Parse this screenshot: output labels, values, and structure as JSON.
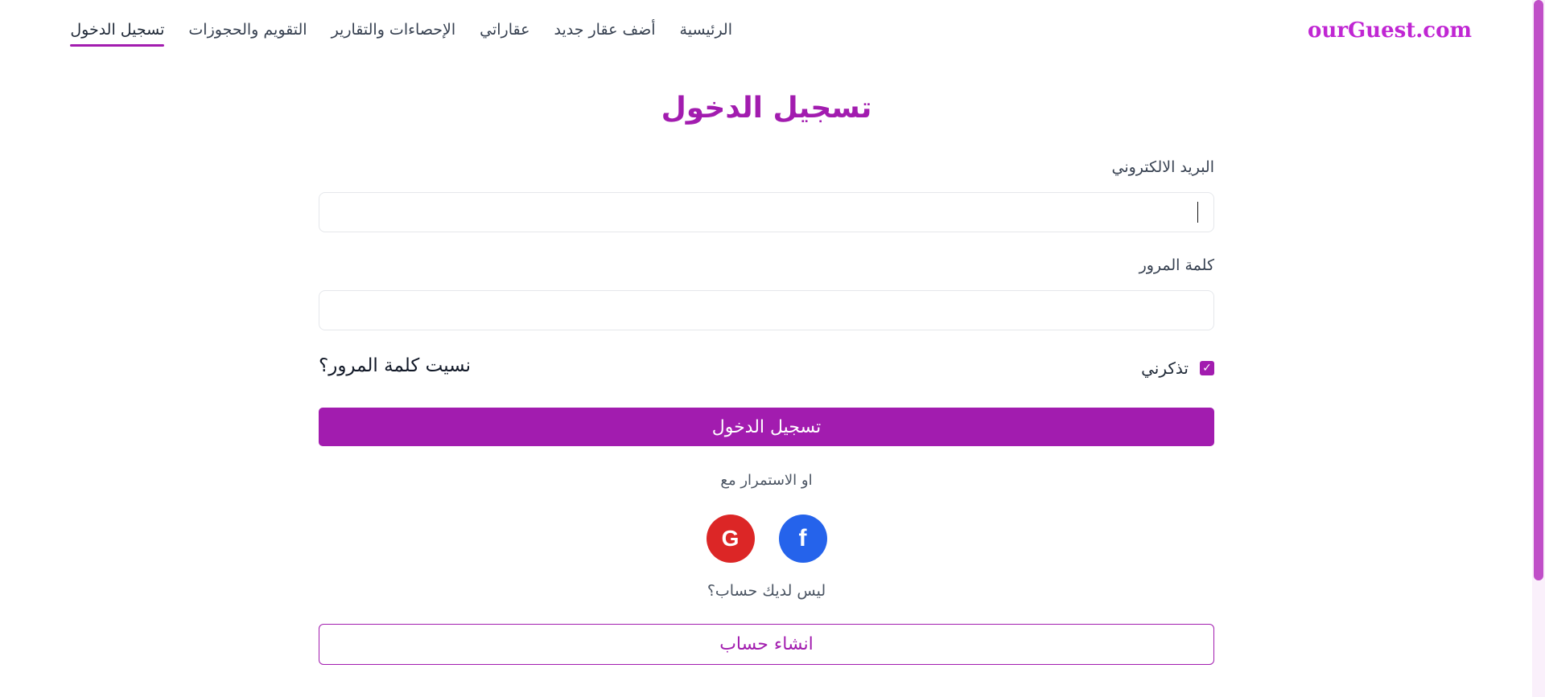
{
  "header": {
    "brand": "ourGuest.com",
    "nav": [
      {
        "label": "الرئيسية"
      },
      {
        "label": "أضف عقار جديد"
      },
      {
        "label": "عقاراتي"
      },
      {
        "label": "الإحصاءات والتقارير"
      },
      {
        "label": "التقويم والحجوزات"
      },
      {
        "label": "تسجيل الدخول",
        "active": true
      }
    ]
  },
  "form": {
    "title": "تسجيل الدخول",
    "email_label": "البريد الالكتروني",
    "email_value": "",
    "password_label": "كلمة المرور",
    "password_value": "",
    "remember_label": "تذكرني",
    "remember_checked": true,
    "forgot_link": "نسيت كلمة المرور؟",
    "submit_label": "تسجيل الدخول",
    "or_continue": "او الاستمرار مع",
    "no_account": "ليس لديك حساب؟",
    "create_account_label": "انشاء حساب"
  },
  "social": {
    "facebook": {
      "icon": "facebook-icon",
      "glyph": "f",
      "color": "#2563eb"
    },
    "google": {
      "icon": "google-icon",
      "glyph": "G",
      "color": "#dc2626"
    }
  },
  "colors": {
    "accent": "#a21caf",
    "brand": "#c026d3"
  }
}
